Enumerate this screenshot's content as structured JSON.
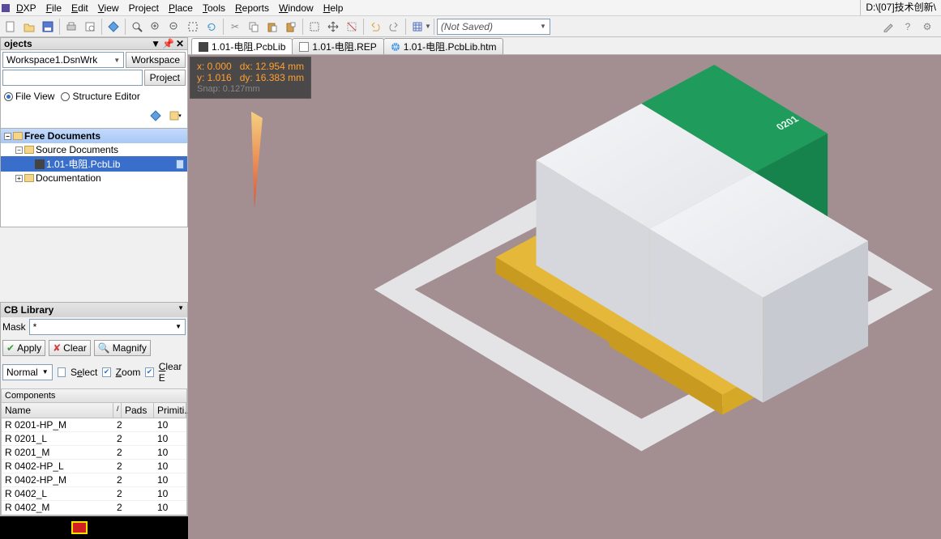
{
  "title_path": "D:\\[07]技术创新\\",
  "menu": {
    "dxp": "DXP",
    "file": "File",
    "edit": "Edit",
    "view": "View",
    "project": "Project",
    "place": "Place",
    "tools": "Tools",
    "reports": "Reports",
    "window": "Window",
    "help": "Help"
  },
  "toolbar": {
    "not_saved": "(Not Saved)"
  },
  "projects": {
    "title": "ojects",
    "workspace_combo": "Workspace1.DsnWrk",
    "workspace_btn": "Workspace",
    "project_btn": "Project",
    "file_view": "File View",
    "structure_editor": "Structure Editor",
    "tree": {
      "free_docs": "Free Documents",
      "source_docs": "Source Documents",
      "file1": "1.01-电阻.PcbLib",
      "documentation": "Documentation"
    }
  },
  "pcblib": {
    "title": "CB Library",
    "mask_label": "Mask",
    "mask_value": "*",
    "apply": "Apply",
    "clear": "Clear",
    "magnify": "Magnify",
    "normal": "Normal",
    "select": "Select",
    "zoom": "Zoom",
    "clear_e": "Clear E",
    "components": "Components",
    "col_name": "Name",
    "col_pads": "Pads",
    "col_prim": "Primiti...",
    "rows": [
      {
        "name": "R 0201-HP_M",
        "pads": "2",
        "prim": "10"
      },
      {
        "name": "R 0201_L",
        "pads": "2",
        "prim": "10"
      },
      {
        "name": "R 0201_M",
        "pads": "2",
        "prim": "10"
      },
      {
        "name": "R 0402-HP_L",
        "pads": "2",
        "prim": "10"
      },
      {
        "name": "R 0402-HP_M",
        "pads": "2",
        "prim": "10"
      },
      {
        "name": "R 0402_L",
        "pads": "2",
        "prim": "10"
      },
      {
        "name": "R 0402_M",
        "pads": "2",
        "prim": "10"
      }
    ]
  },
  "tabs": {
    "t1": "1.01-电阻.PcbLib",
    "t2": "1.01-电阻.REP",
    "t3": "1.01-电阻.PcbLib.htm"
  },
  "hud": {
    "line1a": "x:  0.000",
    "line1b": "dx: 12.954  mm",
    "line2a": "y:  1.016",
    "line2b": "dy: 16.383  mm",
    "snap": "Snap: 0.127mm"
  },
  "component_label": "0201"
}
